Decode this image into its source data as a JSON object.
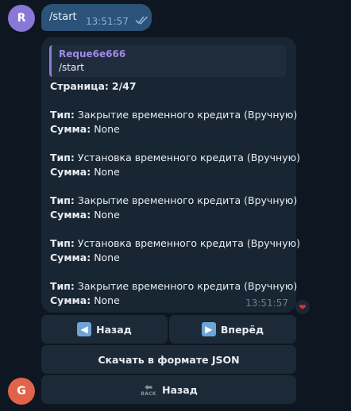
{
  "outgoing": {
    "avatar_letter": "R",
    "text": "/start",
    "time": "13:51:57",
    "status": "read"
  },
  "incoming": {
    "reply": {
      "author": "Reque6e666",
      "text": "/start"
    },
    "page_label": "Страница:",
    "page_value": "2/47",
    "type_label": "Тип:",
    "sum_label": "Сумма:",
    "entries": [
      {
        "type": "Закрытие временного кредита (Вручную)",
        "sum": "None"
      },
      {
        "type": "Установка временного кредита (Вручную)",
        "sum": "None"
      },
      {
        "type": "Закрытие временного кредита (Вручную)",
        "sum": "None"
      },
      {
        "type": "Установка временного кредита (Вручную)",
        "sum": "None"
      },
      {
        "type": "Закрытие временного кредита (Вручную)",
        "sum": "None"
      }
    ],
    "time": "13:51:57",
    "reaction": "heart"
  },
  "keyboard": {
    "back_label": "Назад",
    "forward_label": "Вперёд",
    "json_label": "Скачать в формате JSON",
    "back2_label": "Назад",
    "back_icon_text": "BACK"
  },
  "bot_avatar_letter": "G",
  "colors": {
    "background": "#0e1621",
    "outgoing_bubble": "#2b5278",
    "incoming_bubble": "#182533",
    "button": "#1c2a38",
    "accent_name": "#a08be8"
  }
}
